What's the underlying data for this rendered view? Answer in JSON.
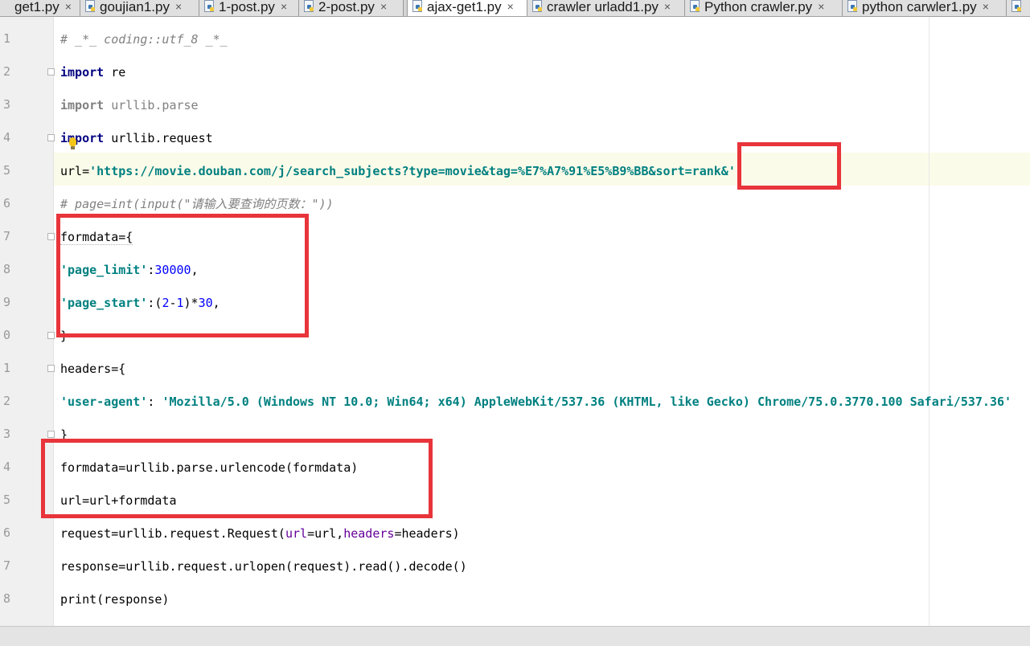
{
  "tabs": [
    {
      "label": "get1.py",
      "active": false
    },
    {
      "label": "goujian1.py",
      "active": false
    },
    {
      "label": "1-post.py",
      "active": false
    },
    {
      "label": "2-post.py",
      "active": false
    },
    {
      "label": "ajax-get1.py",
      "active": true
    },
    {
      "label": "crawler urladd1.py",
      "active": false
    },
    {
      "label": "Python crawler.py",
      "active": false
    },
    {
      "label": "python carwler1.py",
      "active": false
    }
  ],
  "close_glyph": "×",
  "line_numbers": [
    "1",
    "2",
    "3",
    "4",
    "5",
    "6",
    "7",
    "8",
    "9",
    "0",
    "1",
    "2",
    "3",
    "4",
    "5",
    "6",
    "7",
    "8"
  ],
  "code": {
    "l1": "# _*_ coding::utf_8 _*_",
    "l2_kw": "import",
    "l2_rest": " re",
    "l3_kw": "import",
    "l3_rest": " urllib.parse",
    "l4_kw": "import",
    "l4_rest": " urllib.request",
    "l5_pre": "url=",
    "l5_str": "'https://movie.douban.com/j/search_subjects?type=movie&tag=%E7%A7%91%E5%B9%BB&sort=rank&'",
    "l6": "# page=int(input(\"请输入要查询的页数：\"))",
    "l7": "formdata={",
    "l8_str": "'page_limit'",
    "l8_mid": ":",
    "l8_num": "30000",
    "l8_end": ",",
    "l9_str": "'page_start'",
    "l9_a": ":(",
    "l9_n1": "2",
    "l9_b": "-",
    "l9_n2": "1",
    "l9_c": ")*",
    "l9_n3": "30",
    "l9_d": ",",
    "l10": "}",
    "l11": "headers={",
    "l12_key": "'user-agent'",
    "l12_mid": ": ",
    "l12_val": "'Mozilla/5.0 (Windows NT 10.0; Win64; x64) AppleWebKit/537.36 (KHTML, like Gecko) Chrome/75.0.3770.100 Safari/537.36'",
    "l13": "}",
    "l14": "formdata=urllib.parse.urlencode(formdata)",
    "l15": "url=url+formdata",
    "l16_a": "request=urllib.request.Request(",
    "l16_kw1": "url",
    "l16_b": "=url,",
    "l16_kw2": "headers",
    "l16_c": "=headers)",
    "l17": "response=urllib.request.urlopen(request).read().decode()",
    "l18": "print(response)"
  }
}
